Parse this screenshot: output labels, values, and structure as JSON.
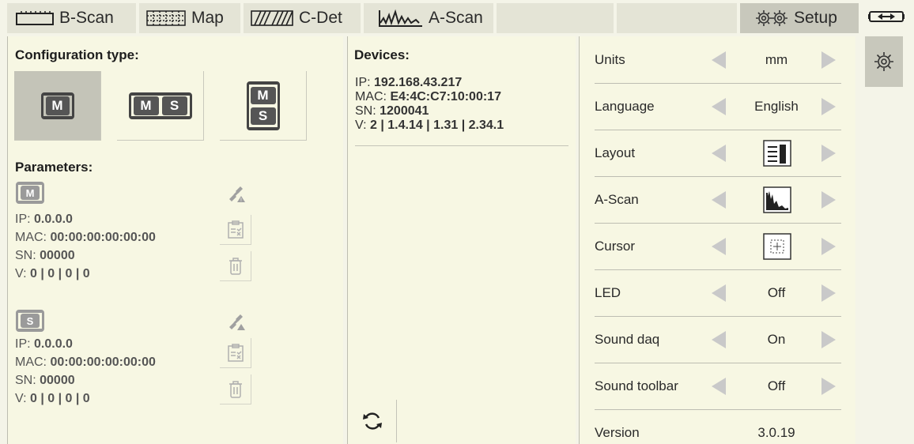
{
  "tabs": [
    {
      "label": "B-Scan",
      "icon": "bscan-icon"
    },
    {
      "label": "Map",
      "icon": "map-grid-icon"
    },
    {
      "label": "C-Det",
      "icon": "cdet-icon"
    },
    {
      "label": "A-Scan",
      "icon": "ascan-waveform-icon"
    },
    {
      "label": "Setup",
      "icon": "gears-icon",
      "active": true
    }
  ],
  "config": {
    "title": "Configuration type:",
    "options": [
      {
        "chips": [
          "M"
        ],
        "selected": true
      },
      {
        "chips": [
          "M",
          "S"
        ],
        "selected": false
      },
      {
        "chips": [
          "M",
          "S"
        ],
        "stacked": true,
        "selected": false
      }
    ]
  },
  "parameters": {
    "title": "Parameters:",
    "master": {
      "chip": "M",
      "ip_label": "IP:",
      "ip": "0.0.0.0",
      "mac_label": "MAC:",
      "mac": "00:00:00:00:00:00",
      "sn_label": "SN:",
      "sn": "00000",
      "v_label": "V:",
      "v": "0 | 0 | 0 | 0"
    },
    "slave": {
      "chip": "S",
      "ip_label": "IP:",
      "ip": "0.0.0.0",
      "mac_label": "MAC:",
      "mac": "00:00:00:00:00:00",
      "sn_label": "SN:",
      "sn": "00000",
      "v_label": "V:",
      "v": "0 | 0 | 0 | 0"
    }
  },
  "devices": {
    "title": "Devices:",
    "ip_label": "IP:",
    "ip": "192.168.43.217",
    "mac_label": "MAC:",
    "mac": "E4:4C:C7:10:00:17",
    "sn_label": "SN:",
    "sn": "1200041",
    "v_label": "V:",
    "v": "2 | 1.4.14 | 1.31 | 2.34.1"
  },
  "settings": [
    {
      "label": "Units",
      "value": "mm"
    },
    {
      "label": "Language",
      "value": "English"
    },
    {
      "label": "Layout",
      "icon": "layout-icon"
    },
    {
      "label": "A-Scan",
      "icon": "ascan-fill-icon"
    },
    {
      "label": "Cursor",
      "icon": "cursor-box-icon"
    },
    {
      "label": "LED",
      "value": "Off"
    },
    {
      "label": "Sound daq",
      "value": "On"
    },
    {
      "label": "Sound toolbar",
      "value": "Off"
    },
    {
      "label": "Version",
      "value": "3.0.19"
    }
  ],
  "colors": {
    "accent": "#c8c8bc",
    "panel": "#f7f7e3",
    "arrow": "#c9c9c9"
  }
}
